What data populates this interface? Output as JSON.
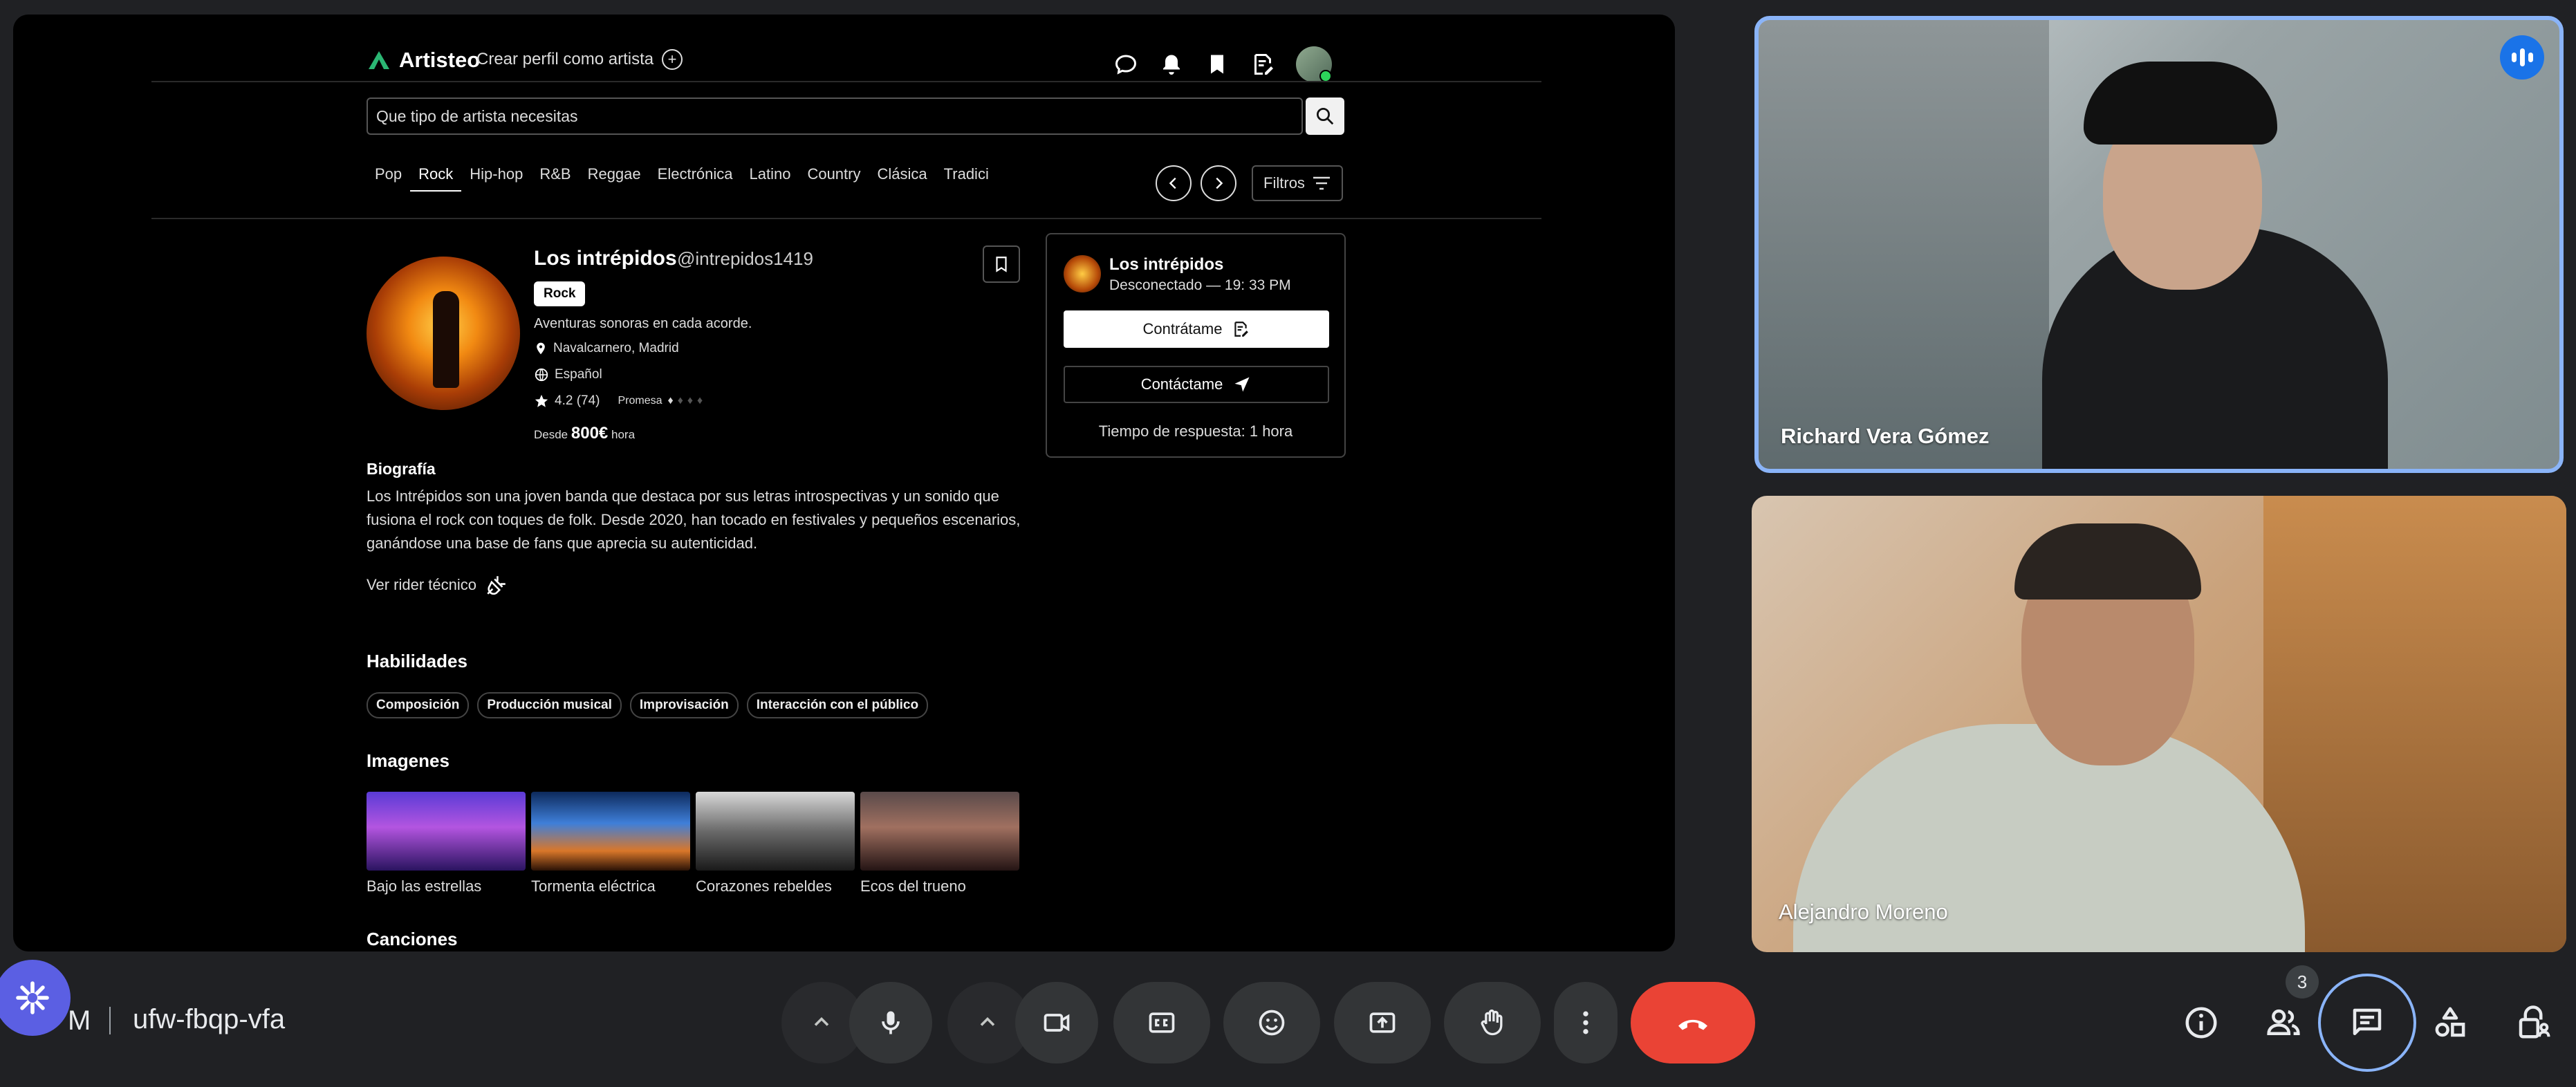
{
  "site": {
    "brand": "Artisteo",
    "create_profile": "Crear perfil como artista",
    "search_placeholder": "Que tipo de artista necesitas",
    "categories": [
      "Pop",
      "Rock",
      "Hip-hop",
      "R&B",
      "Reggae",
      "Electrónica",
      "Latino",
      "Country",
      "Clásica",
      "Tradici"
    ],
    "active_category": "Rock",
    "filters_label": "Filtros"
  },
  "artist": {
    "name": "Los intrépidos",
    "handle": "@intrepidos1419",
    "genre_badge": "Rock",
    "tagline": "Aventuras sonoras en cada acorde.",
    "location": "Navalcarnero, Madrid",
    "language": "Español",
    "rating": "4.2 (74)",
    "level_label": "Promesa",
    "from_label": "Desde",
    "price": "800€",
    "price_unit": "hora",
    "bio_title": "Biografía",
    "bio_text": "Los Intrépidos son una joven banda que destaca por sus letras introspectivas y un sonido que fusiona el rock con toques de folk. Desde 2020, han tocado en festivales y pequeños escenarios, ganándose una base de fans que aprecia su autenticidad.",
    "rider_link": "Ver rider técnico",
    "skills_title": "Habilidades",
    "skills": [
      "Composición",
      "Producción musical",
      "Improvisación",
      "Interacción con el público"
    ],
    "images_title": "Imagenes",
    "images": [
      "Bajo las estrellas",
      "Tormenta eléctrica",
      "Corazones rebeldes",
      "Ecos del trueno"
    ],
    "songs_title": "Canciones"
  },
  "contact_card": {
    "name": "Los intrépidos",
    "status": "Desconectado — 19: 33 PM",
    "hire_button": "Contrátame",
    "contact_button": "Contáctame",
    "response_time": "Tiempo de respuesta: 1 hora"
  },
  "participants": [
    {
      "name": "Richard Vera Gómez",
      "speaking": true
    },
    {
      "name": "Alejandro Moreno",
      "speaking": false
    }
  ],
  "meeting": {
    "time_suffix": "M",
    "code": "ufw-fbqp-vfa",
    "people_count": "3"
  },
  "colors": {
    "end_call": "#ea4335",
    "active_tile_border": "#8ab4f8",
    "brand_accent": "#2bb673"
  }
}
